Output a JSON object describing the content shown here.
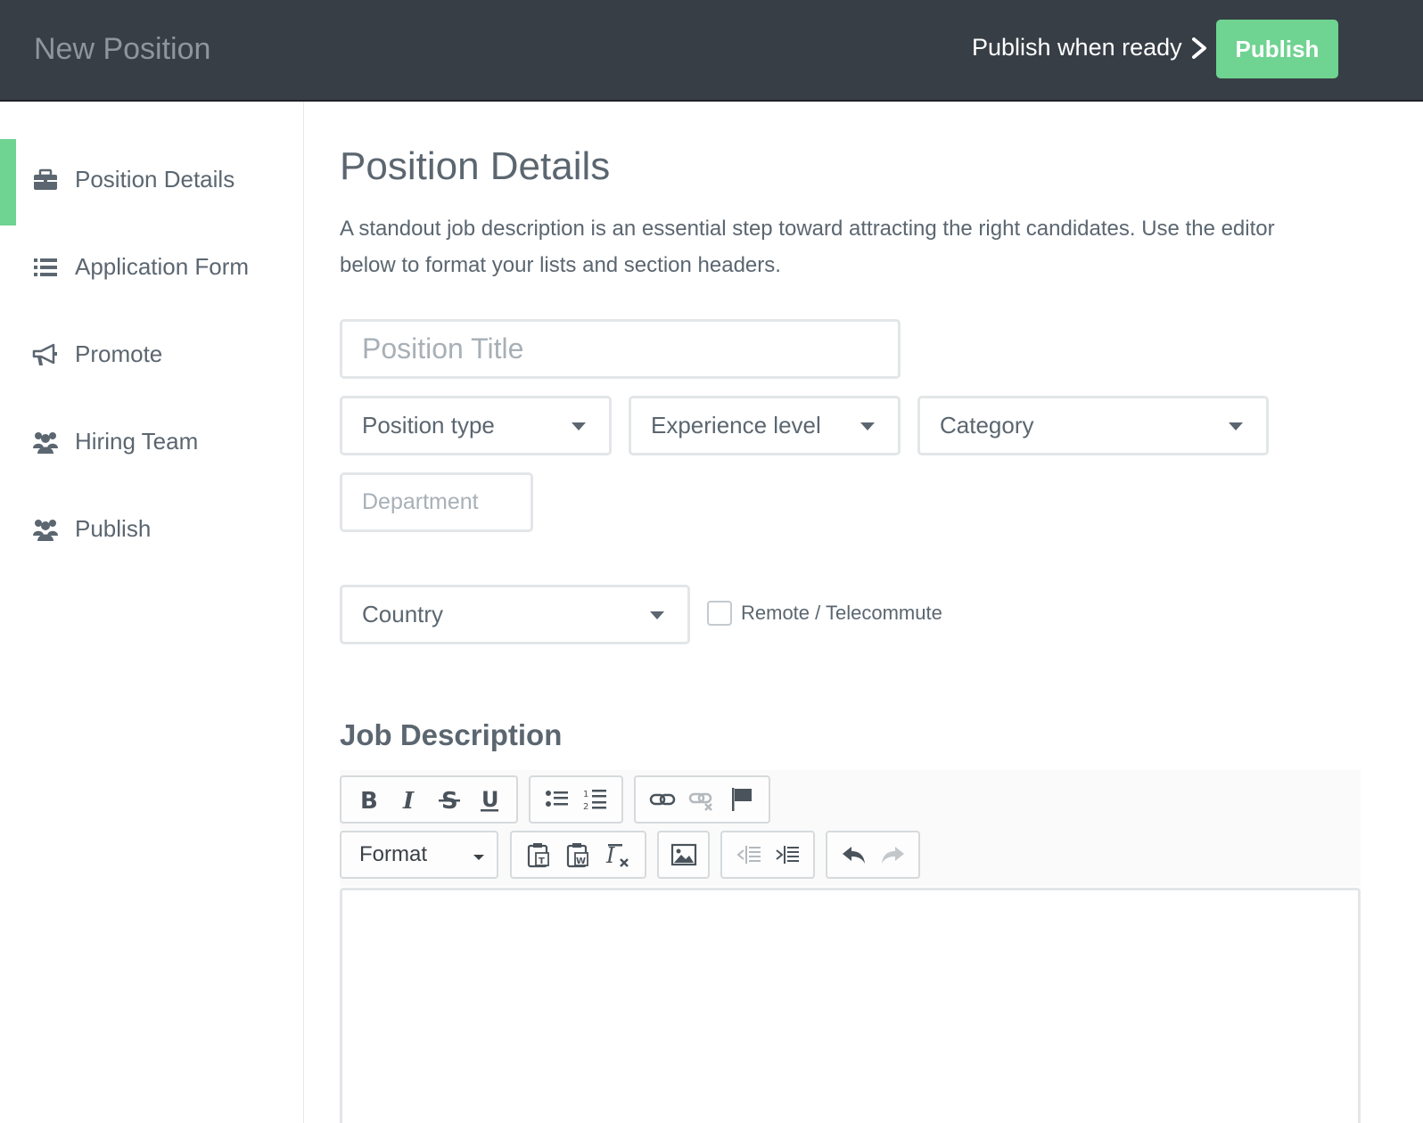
{
  "header": {
    "title": "New Position",
    "publish_when_ready": "Publish when ready",
    "publish_button": "Publish"
  },
  "sidebar": {
    "items": [
      {
        "label": "Position Details",
        "icon": "briefcase-icon",
        "active": true
      },
      {
        "label": "Application Form",
        "icon": "list-icon",
        "active": false
      },
      {
        "label": "Promote",
        "icon": "megaphone-icon",
        "active": false
      },
      {
        "label": "Hiring Team",
        "icon": "users-icon",
        "active": false
      },
      {
        "label": "Publish",
        "icon": "users-icon",
        "active": false
      }
    ]
  },
  "main": {
    "title": "Position Details",
    "description": "A standout job description is an essential step toward attracting the right candidates. Use the editor below to format your lists and section headers.",
    "position_title_placeholder": "Position Title",
    "position_type": "Position type",
    "experience_level": "Experience level",
    "category": "Category",
    "department_placeholder": "Department",
    "country": "Country",
    "remote_label": "Remote / Telecommute",
    "job_description_title": "Job Description",
    "format_label": "Format"
  },
  "colors": {
    "header_bg": "#373e46",
    "accent_green": "#6fd391",
    "text": "#5b6670"
  }
}
